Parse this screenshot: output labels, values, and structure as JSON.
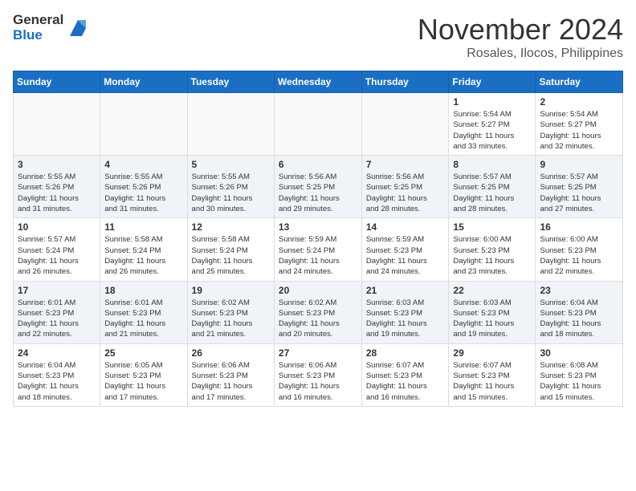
{
  "header": {
    "logo_line1": "General",
    "logo_line2": "Blue",
    "month": "November 2024",
    "location": "Rosales, Ilocos, Philippines"
  },
  "weekdays": [
    "Sunday",
    "Monday",
    "Tuesday",
    "Wednesday",
    "Thursday",
    "Friday",
    "Saturday"
  ],
  "weeks": [
    [
      {
        "day": "",
        "info": ""
      },
      {
        "day": "",
        "info": ""
      },
      {
        "day": "",
        "info": ""
      },
      {
        "day": "",
        "info": ""
      },
      {
        "day": "",
        "info": ""
      },
      {
        "day": "1",
        "info": "Sunrise: 5:54 AM\nSunset: 5:27 PM\nDaylight: 11 hours\nand 33 minutes."
      },
      {
        "day": "2",
        "info": "Sunrise: 5:54 AM\nSunset: 5:27 PM\nDaylight: 11 hours\nand 32 minutes."
      }
    ],
    [
      {
        "day": "3",
        "info": "Sunrise: 5:55 AM\nSunset: 5:26 PM\nDaylight: 11 hours\nand 31 minutes."
      },
      {
        "day": "4",
        "info": "Sunrise: 5:55 AM\nSunset: 5:26 PM\nDaylight: 11 hours\nand 31 minutes."
      },
      {
        "day": "5",
        "info": "Sunrise: 5:55 AM\nSunset: 5:26 PM\nDaylight: 11 hours\nand 30 minutes."
      },
      {
        "day": "6",
        "info": "Sunrise: 5:56 AM\nSunset: 5:25 PM\nDaylight: 11 hours\nand 29 minutes."
      },
      {
        "day": "7",
        "info": "Sunrise: 5:56 AM\nSunset: 5:25 PM\nDaylight: 11 hours\nand 28 minutes."
      },
      {
        "day": "8",
        "info": "Sunrise: 5:57 AM\nSunset: 5:25 PM\nDaylight: 11 hours\nand 28 minutes."
      },
      {
        "day": "9",
        "info": "Sunrise: 5:57 AM\nSunset: 5:25 PM\nDaylight: 11 hours\nand 27 minutes."
      }
    ],
    [
      {
        "day": "10",
        "info": "Sunrise: 5:57 AM\nSunset: 5:24 PM\nDaylight: 11 hours\nand 26 minutes."
      },
      {
        "day": "11",
        "info": "Sunrise: 5:58 AM\nSunset: 5:24 PM\nDaylight: 11 hours\nand 26 minutes."
      },
      {
        "day": "12",
        "info": "Sunrise: 5:58 AM\nSunset: 5:24 PM\nDaylight: 11 hours\nand 25 minutes."
      },
      {
        "day": "13",
        "info": "Sunrise: 5:59 AM\nSunset: 5:24 PM\nDaylight: 11 hours\nand 24 minutes."
      },
      {
        "day": "14",
        "info": "Sunrise: 5:59 AM\nSunset: 5:23 PM\nDaylight: 11 hours\nand 24 minutes."
      },
      {
        "day": "15",
        "info": "Sunrise: 6:00 AM\nSunset: 5:23 PM\nDaylight: 11 hours\nand 23 minutes."
      },
      {
        "day": "16",
        "info": "Sunrise: 6:00 AM\nSunset: 5:23 PM\nDaylight: 11 hours\nand 22 minutes."
      }
    ],
    [
      {
        "day": "17",
        "info": "Sunrise: 6:01 AM\nSunset: 5:23 PM\nDaylight: 11 hours\nand 22 minutes."
      },
      {
        "day": "18",
        "info": "Sunrise: 6:01 AM\nSunset: 5:23 PM\nDaylight: 11 hours\nand 21 minutes."
      },
      {
        "day": "19",
        "info": "Sunrise: 6:02 AM\nSunset: 5:23 PM\nDaylight: 11 hours\nand 21 minutes."
      },
      {
        "day": "20",
        "info": "Sunrise: 6:02 AM\nSunset: 5:23 PM\nDaylight: 11 hours\nand 20 minutes."
      },
      {
        "day": "21",
        "info": "Sunrise: 6:03 AM\nSunset: 5:23 PM\nDaylight: 11 hours\nand 19 minutes."
      },
      {
        "day": "22",
        "info": "Sunrise: 6:03 AM\nSunset: 5:23 PM\nDaylight: 11 hours\nand 19 minutes."
      },
      {
        "day": "23",
        "info": "Sunrise: 6:04 AM\nSunset: 5:23 PM\nDaylight: 11 hours\nand 18 minutes."
      }
    ],
    [
      {
        "day": "24",
        "info": "Sunrise: 6:04 AM\nSunset: 5:23 PM\nDaylight: 11 hours\nand 18 minutes."
      },
      {
        "day": "25",
        "info": "Sunrise: 6:05 AM\nSunset: 5:23 PM\nDaylight: 11 hours\nand 17 minutes."
      },
      {
        "day": "26",
        "info": "Sunrise: 6:06 AM\nSunset: 5:23 PM\nDaylight: 11 hours\nand 17 minutes."
      },
      {
        "day": "27",
        "info": "Sunrise: 6:06 AM\nSunset: 5:23 PM\nDaylight: 11 hours\nand 16 minutes."
      },
      {
        "day": "28",
        "info": "Sunrise: 6:07 AM\nSunset: 5:23 PM\nDaylight: 11 hours\nand 16 minutes."
      },
      {
        "day": "29",
        "info": "Sunrise: 6:07 AM\nSunset: 5:23 PM\nDaylight: 11 hours\nand 15 minutes."
      },
      {
        "day": "30",
        "info": "Sunrise: 6:08 AM\nSunset: 5:23 PM\nDaylight: 11 hours\nand 15 minutes."
      }
    ]
  ]
}
